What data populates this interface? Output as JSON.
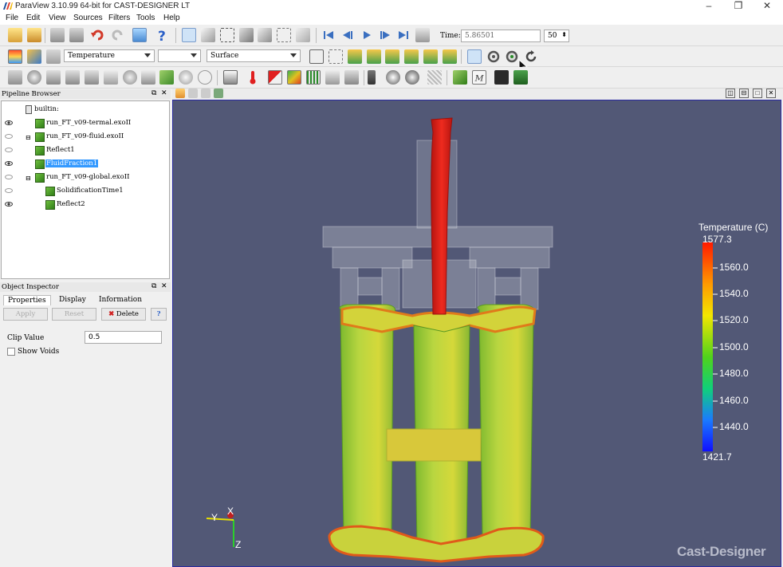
{
  "window": {
    "title": "ParaView 3.10.99 64-bit for CAST-DESIGNER LT",
    "minimize": "–",
    "maximize": "❐",
    "close": "✕"
  },
  "menu": [
    "File",
    "Edit",
    "View",
    "Sources",
    "Filters",
    "Tools",
    "Help"
  ],
  "toolbar": {
    "time_label": "Time:",
    "time_value": "5.86501",
    "frame_value": "50",
    "color_by": "Temperature",
    "color_component": "",
    "representation": "Surface"
  },
  "pipeline": {
    "title": "Pipeline Browser",
    "root": "builtin:",
    "items": [
      {
        "label": "run_FT_v09-termal.exoII",
        "visible": true
      },
      {
        "label": "run_FT_v09-fluid.exoII",
        "visible": false
      },
      {
        "label": "Reflect1",
        "visible": false
      },
      {
        "label": "FluidFraction1",
        "visible": true,
        "selected": true
      },
      {
        "label": "run_FT_v09-global.exoII",
        "visible": false
      },
      {
        "label": "SolidificationTime1",
        "visible": false
      },
      {
        "label": "Reflect2",
        "visible": true
      }
    ]
  },
  "inspector": {
    "title": "Object Inspector",
    "tabs": [
      "Properties",
      "Display",
      "Information"
    ],
    "apply": "Apply",
    "reset": "Reset",
    "delete": "Delete",
    "help": "?",
    "clip_label": "Clip Value",
    "clip_value": "0.5",
    "show_voids": "Show Voids"
  },
  "view": {
    "colorbar_title": "Temperature (C)",
    "colorbar_labels": [
      "1577.3",
      "1560.0",
      "1540.0",
      "1520.0",
      "1500.0",
      "1480.0",
      "1460.0",
      "1440.0",
      "1421.7"
    ],
    "colorbar_min": 1421.7,
    "colorbar_max": 1577.3,
    "axes": {
      "x": "X",
      "y": "Y",
      "z": "Z"
    },
    "brand": "Cast-Designer"
  },
  "colors": {
    "view_background": "#525876",
    "selection": "#3399ff",
    "sprue_red": "#e8221a",
    "casting_green": "#9ac93a"
  }
}
